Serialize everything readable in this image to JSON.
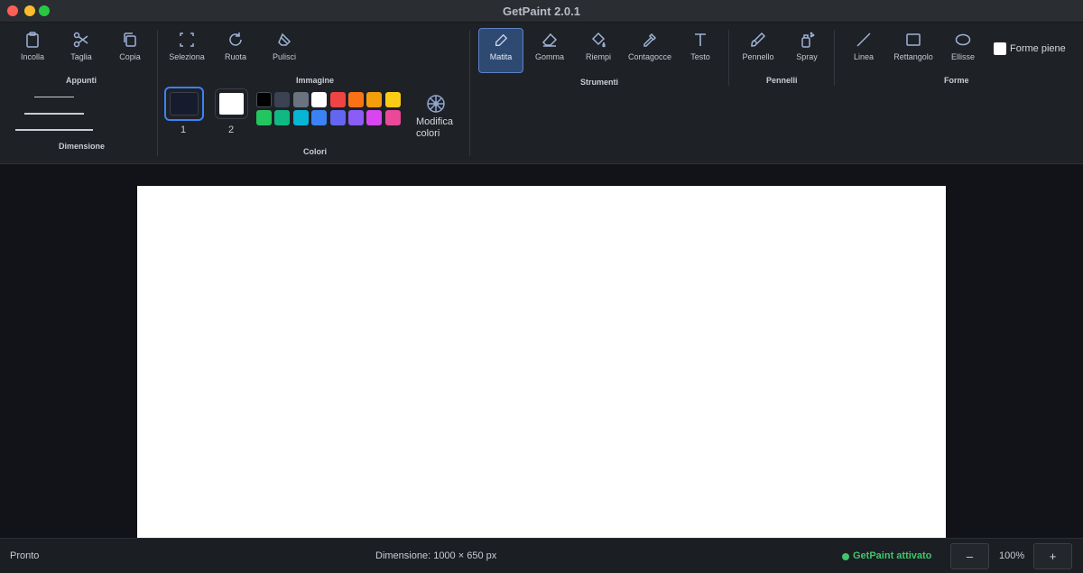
{
  "window": {
    "title": "GetPaint 2.0.1"
  },
  "clipboard": {
    "label": "Appunti",
    "paste": "Incolla",
    "cut": "Taglia",
    "copy": "Copia"
  },
  "size": {
    "label": "Dimensione"
  },
  "image": {
    "label": "Immagine",
    "select": "Seleziona",
    "rotate": "Ruota",
    "clear": "Pulisci"
  },
  "colors": {
    "label": "Colori",
    "color1_label": "1",
    "color2_label": "2",
    "color1_value": "#161c2e",
    "color2_value": "#ffffff",
    "edit_label": "Modifica colori",
    "palette": [
      "#000000",
      "#3b4252",
      "#6b7280",
      "#ffffff",
      "#ef4444",
      "#f97316",
      "#f59e0b",
      "#facc15",
      "#22c55e",
      "#10b981",
      "#06b6d4",
      "#3b82f6",
      "#6366f1",
      "#8b5cf6",
      "#d946ef",
      "#ec4899"
    ]
  },
  "tools": {
    "label": "Strumenti",
    "pencil": "Matita",
    "eraser": "Gomma",
    "fill": "Riempi",
    "picker": "Contagocce",
    "text": "Testo",
    "active": "pencil"
  },
  "brushes": {
    "label": "Pennelli",
    "brush": "Pennello",
    "spray": "Spray"
  },
  "shapes": {
    "label": "Forme",
    "line": "Linea",
    "rectangle": "Rettangolo",
    "ellipse": "Ellisse",
    "fill_shapes": "Forme piene"
  },
  "status": {
    "state": "Pronto",
    "dimensions": "Dimensione: 1000 × 650 px",
    "activated": "GetPaint attivato",
    "zoom": "100%",
    "zoom_out": "–",
    "zoom_in": "+"
  },
  "accent_color": "#5c83c5"
}
